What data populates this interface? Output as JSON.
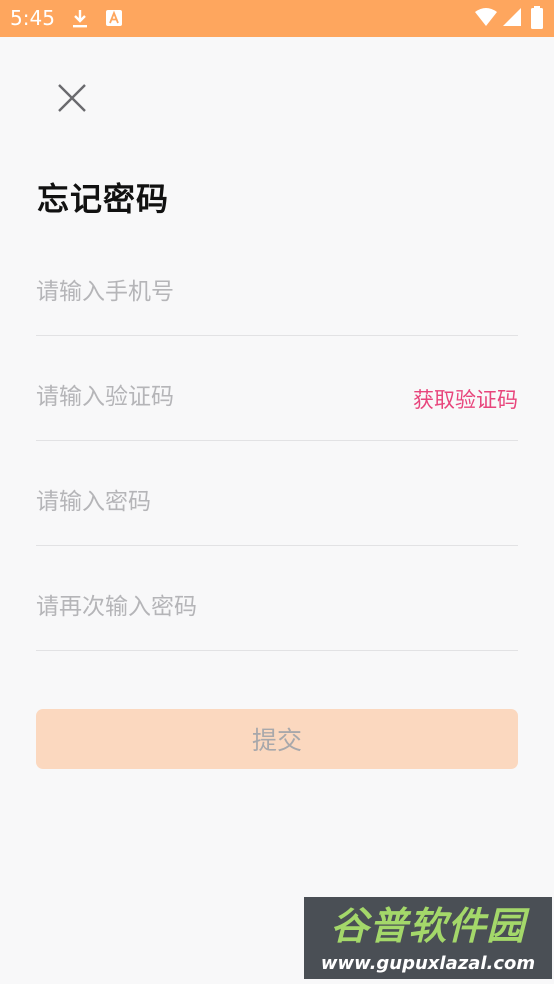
{
  "status_bar": {
    "time": "5:45",
    "icons": [
      "download-icon",
      "a-app-icon",
      "wifi-icon",
      "signal-icon",
      "battery-icon"
    ],
    "background": "#fea65e"
  },
  "header": {
    "close_icon": "close-icon",
    "title": "忘记密码"
  },
  "form": {
    "phone": {
      "placeholder": "请输入手机号",
      "value": ""
    },
    "code": {
      "placeholder": "请输入验证码",
      "value": "",
      "get_code_label": "获取验证码"
    },
    "password": {
      "placeholder": "请输入密码",
      "value": ""
    },
    "confirm_password": {
      "placeholder": "请再次输入密码",
      "value": ""
    },
    "submit_label": "提交"
  },
  "watermark": {
    "line1": "谷普软件园",
    "line2": "www.gupuxlazal.com"
  },
  "colors": {
    "accent_pink": "#e8457c",
    "submit_bg": "#fbd8bf",
    "page_bg": "#f8f8f9"
  }
}
